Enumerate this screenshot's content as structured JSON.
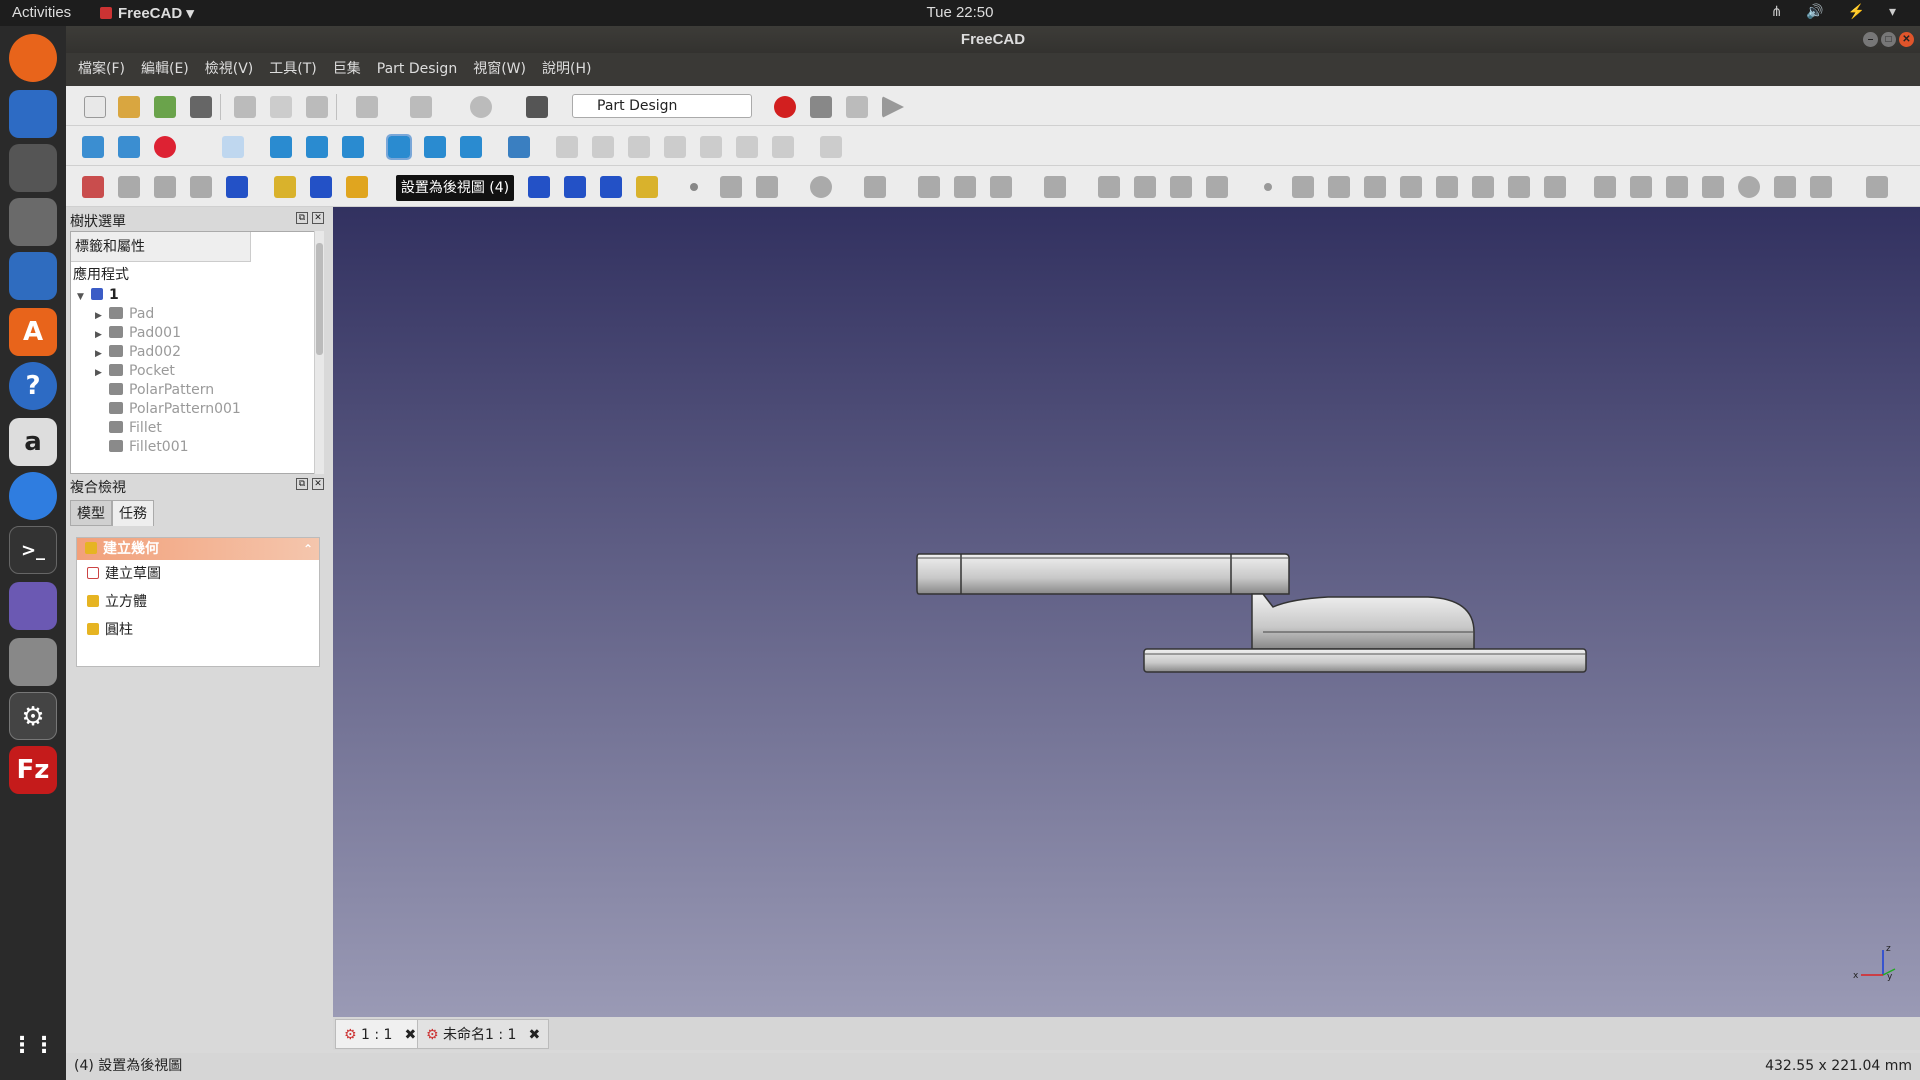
{
  "topbar": {
    "activities": "Activities",
    "app": "FreeCAD ▾",
    "clock": "Tue 22:50",
    "tray": "⋔ 🔊 ⚡ ▾"
  },
  "window": {
    "title": "FreeCAD"
  },
  "menu": [
    "檔案(F)",
    "編輯(E)",
    "檢視(V)",
    "工具(T)",
    "巨集",
    "Part Design",
    "視窗(W)",
    "說明(H)"
  ],
  "workbench": {
    "selected": "Part Design"
  },
  "tooltip": "設置為後視圖 (4)",
  "tree_panel": {
    "title": "樹狀選單",
    "header": "標籤和屬性",
    "section": "應用程式",
    "root": "1",
    "items": [
      "Pad",
      "Pad001",
      "Pad002",
      "Pocket",
      "PolarPattern",
      "PolarPattern001",
      "Fillet",
      "Fillet001"
    ]
  },
  "combo_panel": {
    "title": "複合檢視",
    "tabs": [
      "模型",
      "任務"
    ],
    "task_header": "建立幾何",
    "tasks": [
      "建立草圖",
      "立方體",
      "圓柱"
    ]
  },
  "doc_tabs": [
    "1 : 1",
    "未命名1 : 1"
  ],
  "status": {
    "message": "(4) 設置為後視圖",
    "dimensions": "432.55 x 221.04 mm"
  },
  "colors": {
    "viewport_top": "#323160",
    "viewport_bottom": "#9a9ab5",
    "accent": "#f2a07a"
  }
}
